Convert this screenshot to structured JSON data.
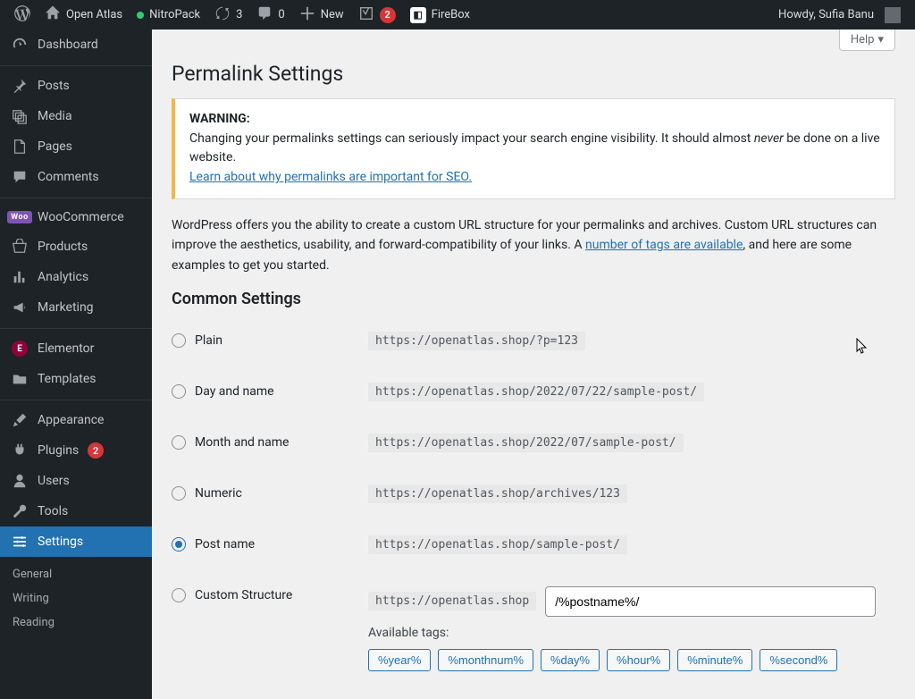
{
  "adminbar": {
    "site_name": "Open Atlas",
    "nitropack": "NitroPack",
    "updates_count": "3",
    "comments_count": "0",
    "new_label": "New",
    "yoast_count": "2",
    "firebox": "FireBox",
    "howdy": "Howdy, Sufia Banu"
  },
  "sidebar": {
    "dashboard": "Dashboard",
    "posts": "Posts",
    "media": "Media",
    "pages": "Pages",
    "comments": "Comments",
    "woocommerce": "WooCommerce",
    "products": "Products",
    "analytics": "Analytics",
    "marketing": "Marketing",
    "elementor": "Elementor",
    "templates": "Templates",
    "appearance": "Appearance",
    "plugins": "Plugins",
    "plugins_count": "2",
    "users": "Users",
    "tools": "Tools",
    "settings": "Settings",
    "sub_general": "General",
    "sub_writing": "Writing",
    "sub_reading": "Reading"
  },
  "page": {
    "help": "Help",
    "title": "Permalink Settings",
    "warning_label": "WARNING:",
    "warning_text_1": "Changing your permalinks settings can seriously impact your search engine visibility. It should almost ",
    "warning_em": "never",
    "warning_text_2": " be done on a live website.",
    "warning_link": "Learn about why permalinks are important for SEO.",
    "intro_1": "WordPress offers you the ability to create a custom URL structure for your permalinks and archives. Custom URL structures can improve the aesthetics, usability, and forward-compatibility of your links. A ",
    "intro_link": "number of tags are available",
    "intro_2": ", and here are some examples to get you started.",
    "common_heading": "Common Settings",
    "options": {
      "plain": {
        "label": "Plain",
        "url": "https://openatlas.shop/?p=123"
      },
      "day": {
        "label": "Day and name",
        "url": "https://openatlas.shop/2022/07/22/sample-post/"
      },
      "month": {
        "label": "Month and name",
        "url": "https://openatlas.shop/2022/07/sample-post/"
      },
      "numeric": {
        "label": "Numeric",
        "url": "https://openatlas.shop/archives/123"
      },
      "postname": {
        "label": "Post name",
        "url": "https://openatlas.shop/sample-post/"
      },
      "custom": {
        "label": "Custom Structure",
        "prefix": "https://openatlas.shop",
        "value": "/%postname%/"
      }
    },
    "available_tags_label": "Available tags:",
    "tags": [
      "%year%",
      "%monthnum%",
      "%day%",
      "%hour%",
      "%minute%",
      "%second%"
    ]
  }
}
